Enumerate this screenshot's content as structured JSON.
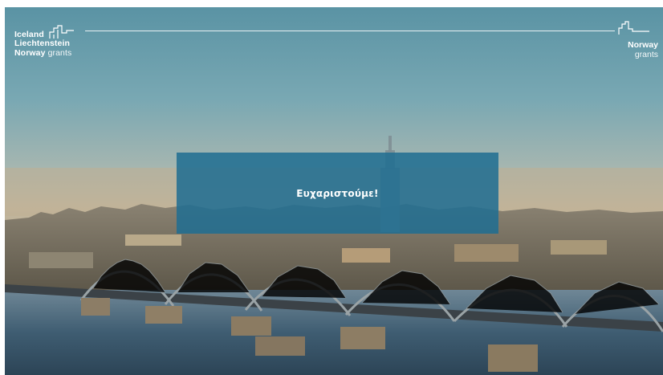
{
  "brand": {
    "left_line1": "Iceland",
    "left_line2": "Liechtenstein",
    "left_line3_bold": "Norway",
    "left_line3_light": "grants",
    "right_line1": "Norway",
    "right_line2": "grants"
  },
  "message": {
    "text": "Ευχαριστούμε!"
  },
  "colors": {
    "panel": "#206e91",
    "sky_top": "#5e97a8",
    "sky_bottom": "#c9b99c",
    "water": "#3d5a6e"
  },
  "icons": {
    "brand_logo": "grants-logo-icon"
  }
}
